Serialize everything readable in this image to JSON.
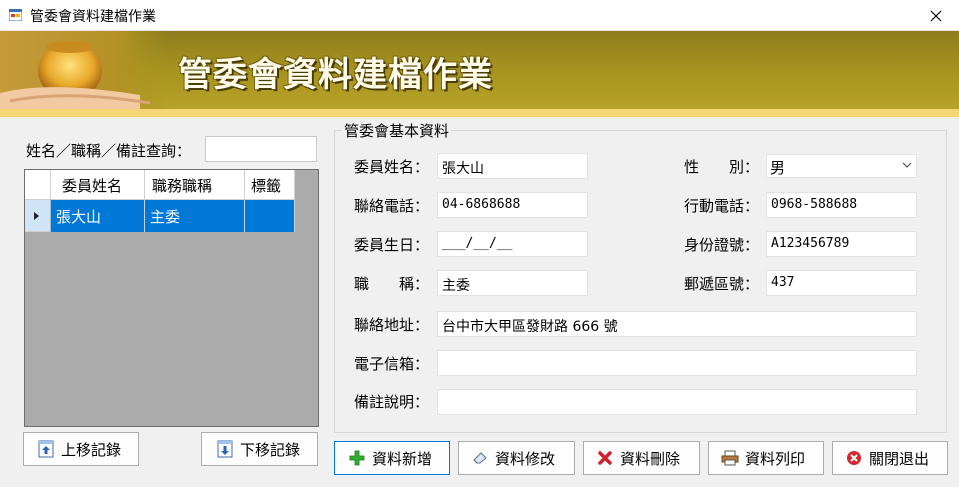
{
  "window": {
    "title": "管委會資料建檔作業"
  },
  "banner": {
    "heading": "管委會資料建檔作業"
  },
  "search": {
    "label": "姓名／職稱／備註查詢：",
    "value": ""
  },
  "grid": {
    "columns": [
      "委員姓名",
      "職務職稱",
      "標籤"
    ],
    "rows": [
      {
        "name": "張大山",
        "title": "主委",
        "tag": ""
      }
    ]
  },
  "nav": {
    "prev_label": "上移記錄",
    "next_label": "下移記錄"
  },
  "group": {
    "title": "管委會基本資料"
  },
  "form": {
    "name_label": "委員姓名：",
    "name_value": "張大山",
    "gender_label": "性　　別：",
    "gender_value": "男",
    "phone_label": "聯絡電話：",
    "phone_value": "04-6868688",
    "mobile_label": "行動電話：",
    "mobile_value": "0968-588688",
    "birthday_label": "委員生日：",
    "birthday_value": "___/__/__",
    "id_label": "身份證號：",
    "id_value": "A123456789",
    "jobtitle_label": "職　　稱：",
    "jobtitle_value": "主委",
    "zip_label": "郵遞區號：",
    "zip_value": "437",
    "address_label": "聯絡地址：",
    "address_value": "台中市大甲區發財路 666 號",
    "email_label": "電子信箱：",
    "email_value": "",
    "note_label": "備註說明：",
    "note_value": ""
  },
  "actions": {
    "add_label": "資料新增",
    "edit_label": "資料修改",
    "delete_label": "資料刪除",
    "print_label": "資料列印",
    "exit_label": "關閉退出"
  },
  "colors": {
    "selection": "#0078d7",
    "banner": "#a8951f",
    "accent_strip": "#f6d778"
  }
}
